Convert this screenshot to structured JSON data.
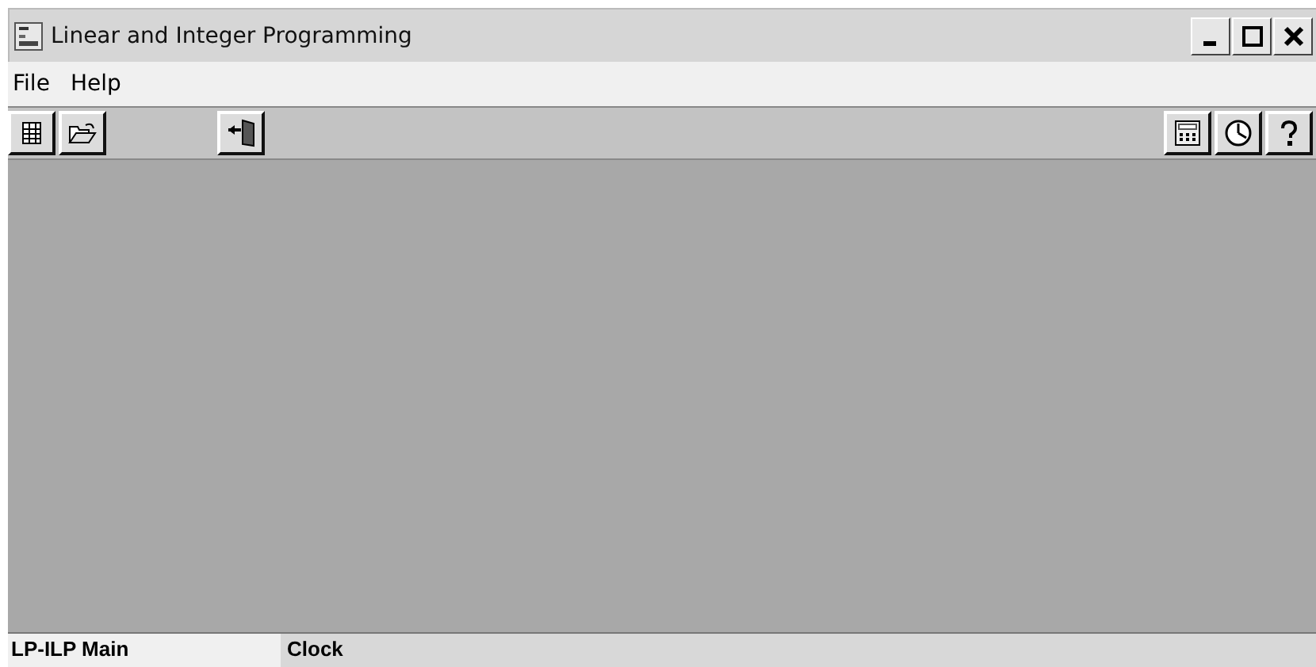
{
  "window": {
    "title": "Linear and Integer Programming"
  },
  "menu": [
    "File",
    "Help"
  ],
  "status_bar": [
    "LP-ILP Main",
    "Clock"
  ]
}
